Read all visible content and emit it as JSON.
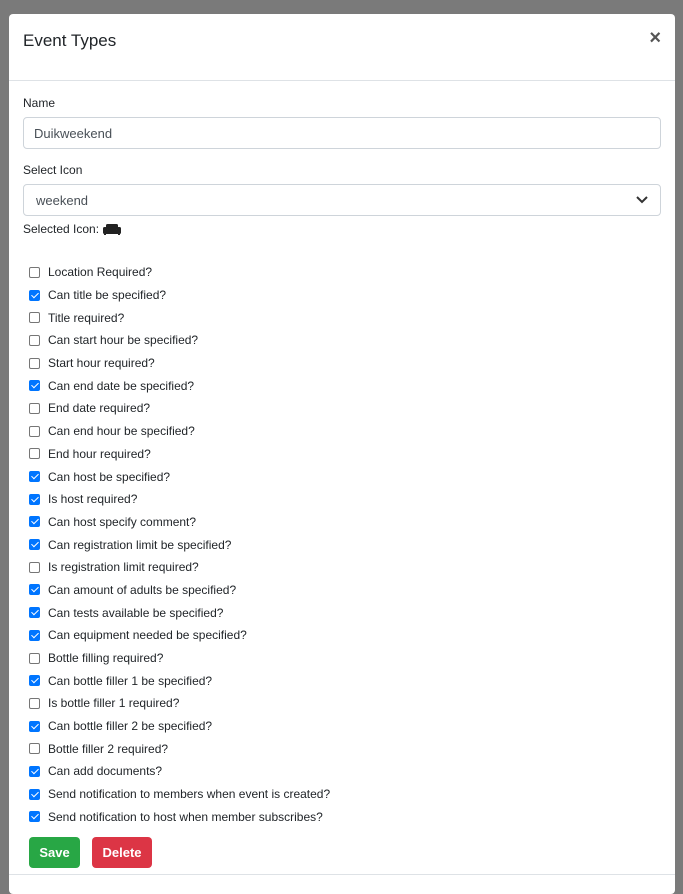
{
  "modal": {
    "title": "Event Types",
    "close_label": "×"
  },
  "form": {
    "name_label": "Name",
    "name_value": "Duikweekend",
    "icon_label": "Select Icon",
    "icon_value": "weekend",
    "selected_icon_label": "Selected Icon:",
    "selected_icon_name": "weekend-sofa-icon"
  },
  "options": [
    {
      "label": "Location Required?",
      "checked": false
    },
    {
      "label": "Can title be specified?",
      "checked": true
    },
    {
      "label": "Title required?",
      "checked": false
    },
    {
      "label": "Can start hour be specified?",
      "checked": false
    },
    {
      "label": "Start hour required?",
      "checked": false
    },
    {
      "label": "Can end date be specified?",
      "checked": true
    },
    {
      "label": "End date required?",
      "checked": false
    },
    {
      "label": "Can end hour be specified?",
      "checked": false
    },
    {
      "label": "End hour required?",
      "checked": false
    },
    {
      "label": "Can host be specified?",
      "checked": true
    },
    {
      "label": "Is host required?",
      "checked": true
    },
    {
      "label": "Can host specify comment?",
      "checked": true
    },
    {
      "label": "Can registration limit be specified?",
      "checked": true
    },
    {
      "label": "Is registration limit required?",
      "checked": false
    },
    {
      "label": "Can amount of adults be specified?",
      "checked": true
    },
    {
      "label": "Can tests available be specified?",
      "checked": true
    },
    {
      "label": "Can equipment needed be specified?",
      "checked": true
    },
    {
      "label": "Bottle filling required?",
      "checked": false
    },
    {
      "label": "Can bottle filler 1 be specified?",
      "checked": true
    },
    {
      "label": "Is bottle filler 1 required?",
      "checked": false
    },
    {
      "label": "Can bottle filler 2 be specified?",
      "checked": true
    },
    {
      "label": "Bottle filler 2 required?",
      "checked": false
    },
    {
      "label": "Can add documents?",
      "checked": true
    },
    {
      "label": "Send notification to members when event is created?",
      "checked": true
    },
    {
      "label": "Send notification to host when member subscribes?",
      "checked": true
    }
  ],
  "buttons": {
    "save": "Save",
    "delete": "Delete"
  },
  "colors": {
    "save": "#28a745",
    "delete": "#dc3545",
    "checkbox_checked": "#0075ff"
  }
}
